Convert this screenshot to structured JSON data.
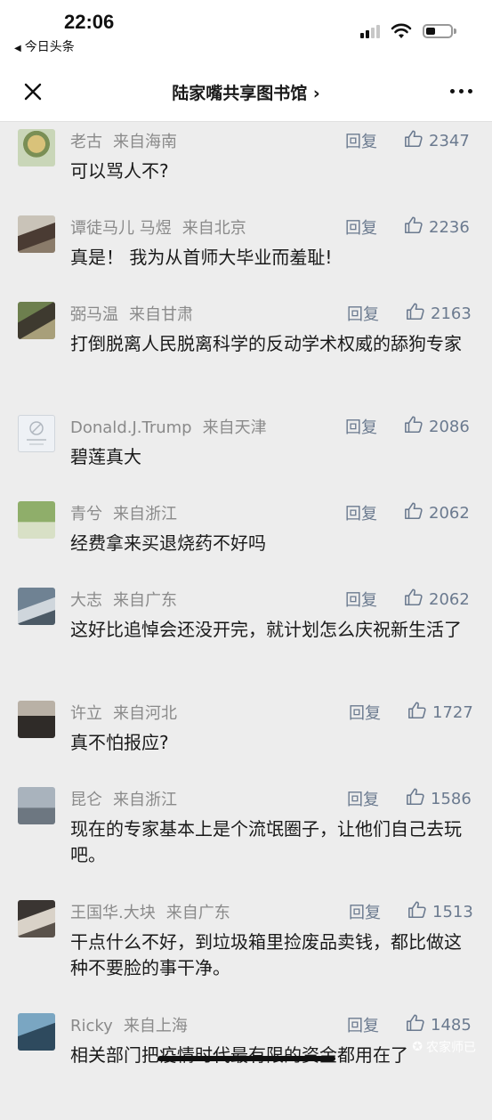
{
  "status_bar": {
    "time": "22:06",
    "back_app": "今日头条"
  },
  "nav": {
    "title": "陆家嘴共享图书馆 ›"
  },
  "comments": [
    {
      "name": "老古",
      "location": "来自海南",
      "reply": "回复",
      "likes": "2347",
      "text": "可以骂人不?"
    },
    {
      "name": "谭徒马儿 马煜",
      "location": "来自北京",
      "reply": "回复",
      "likes": "2236",
      "text": "真是！ 我为从首师大毕业而羞耻!"
    },
    {
      "name": "弼马温",
      "location": "来自甘肃",
      "reply": "回复",
      "likes": "2163",
      "text": "打倒脱离人民脱离科学的反动学术权威的舔狗专家"
    },
    {
      "name": "Donald.J.Trump",
      "location": "来自天津",
      "reply": "回复",
      "likes": "2086",
      "text": "碧莲真大"
    },
    {
      "name": "青兮",
      "location": "来自浙江",
      "reply": "回复",
      "likes": "2062",
      "text": "经费拿来买退烧药不好吗"
    },
    {
      "name": "大志",
      "location": "来自广东",
      "reply": "回复",
      "likes": "2062",
      "text": "这好比追悼会还没开完，就计划怎么庆祝新生活了"
    },
    {
      "name": "许立",
      "location": "来自河北",
      "reply": "回复",
      "likes": "1727",
      "text": "真不怕报应?"
    },
    {
      "name": "昆仑",
      "location": "来自浙江",
      "reply": "回复",
      "likes": "1586",
      "text": "现在的专家基本上是个流氓圈子，让他们自己去玩吧。"
    },
    {
      "name": "王国华.大块",
      "location": "来自广东",
      "reply": "回复",
      "likes": "1513",
      "text": "干点什么不好，到垃圾箱里捡废品卖钱，都比做这种不要脸的事干净。"
    },
    {
      "name": "Ricky",
      "location": "来自上海",
      "reply": "回复",
      "likes": "1485",
      "text": "相关部门把疫情时代最有限的资金都用在了"
    }
  ],
  "watermark": "农家师已",
  "icons": {
    "close": "close-icon",
    "more": "more-icon",
    "like": "thumbs-up-icon",
    "signal": "signal-icon",
    "wifi": "wifi-icon",
    "battery": "battery-icon"
  },
  "colors": {
    "background": "#ededed",
    "name_gray": "#8a8a8a",
    "action_blue_gray": "#6b7a8f",
    "text": "#1a1a1a"
  }
}
